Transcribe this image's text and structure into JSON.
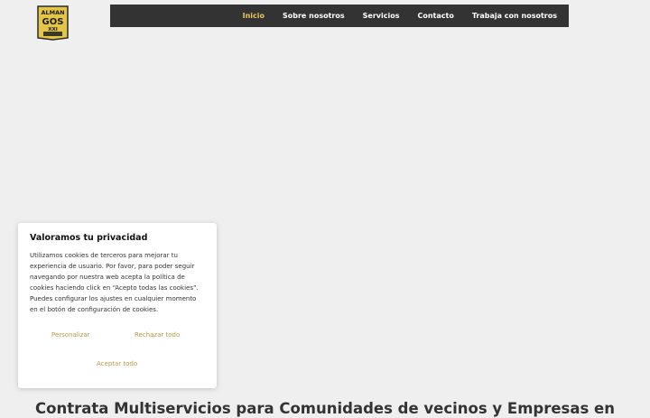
{
  "logo": {
    "line1": "ALMAN",
    "line2": "GOS",
    "line3": "XXI"
  },
  "nav": {
    "items": [
      {
        "label": "Inicio",
        "active": true
      },
      {
        "label": "Sobre nosotros",
        "active": false
      },
      {
        "label": "Servicios",
        "active": false
      },
      {
        "label": "Contacto",
        "active": false
      },
      {
        "label": "Trabaja con nosotros",
        "active": false
      }
    ]
  },
  "cookie": {
    "title": "Valoramos tu privacidad",
    "body": "Utilizamos cookies de terceros para mejorar tu experiencia de usuario. Por favor, para poder seguir navegando por nuestra web acepta la política de cookies haciendo click en “Acepto todas las cookies”. Puedes configurar los ajustes en cualquier momento en el botón de configuración de cookies.",
    "customize_label": "Personalizar",
    "reject_label": "Rechazar todo",
    "accept_label": "Aceptar todo"
  },
  "hero": {
    "headline": "Contrata Multiservicios para Comunidades de vecinos y Empresas en"
  },
  "colors": {
    "accent": "#b89847",
    "nav_bg": "#333333",
    "active": "#e8c760"
  }
}
